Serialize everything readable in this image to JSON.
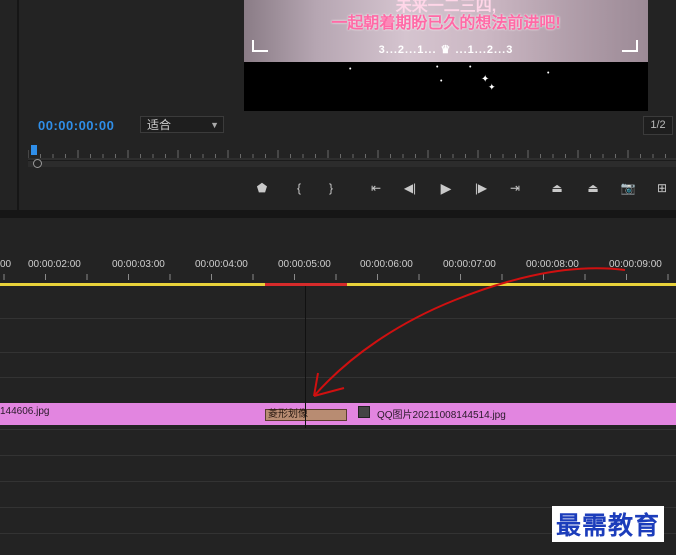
{
  "program_monitor": {
    "overlay_top_text": "未来一二三四,",
    "overlay_main_text": "一起朝着期盼已久的想法前进吧!",
    "overlay_countdown": "3...2...1... ♛ ...1...2...3",
    "timecode": "00:00:00:00",
    "fit_select": {
      "value": "适合"
    },
    "resolution_select": {
      "value": "1/2"
    }
  },
  "transport_controls": [
    {
      "name": "add-marker-button",
      "glyph": "⬟"
    },
    {
      "name": "mark-in-button",
      "glyph": "{"
    },
    {
      "name": "mark-out-button",
      "glyph": "}"
    },
    {
      "name": "go-to-in-button",
      "glyph": "⇤"
    },
    {
      "name": "step-back-button",
      "glyph": "◀|"
    },
    {
      "name": "play-button",
      "glyph": "▶"
    },
    {
      "name": "step-forward-button",
      "glyph": "|▶"
    },
    {
      "name": "go-to-out-button",
      "glyph": "⇥"
    },
    {
      "name": "lift-button",
      "glyph": "⏏"
    },
    {
      "name": "extract-button",
      "glyph": "⏏"
    },
    {
      "name": "export-frame-button",
      "glyph": "📷"
    },
    {
      "name": "button-editor-button",
      "glyph": "⊞"
    }
  ],
  "timeline": {
    "ruler_labels": [
      "00",
      "00:00:02:00",
      "00:00:03:00",
      "00:00:04:00",
      "00:00:05:00",
      "00:00:06:00",
      "00:00:07:00",
      "00:00:08:00",
      "00:00:09:00"
    ],
    "clip_left_label": "144606.jpg",
    "transition_label": "菱形划像",
    "clip_right_label": "QQ图片20211008144514.jpg"
  },
  "watermark": "最需教育",
  "colors": {
    "timecode": "#2f8ee8",
    "clip": "#e285e0",
    "transition": "#b88c72",
    "work_area": "#e8d23a",
    "annotation_arrow": "#d01010"
  }
}
